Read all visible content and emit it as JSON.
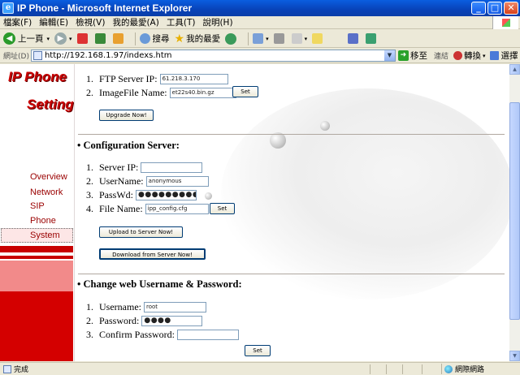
{
  "window": {
    "title": "IP Phone - Microsoft Internet Explorer",
    "minimize": "_",
    "maximize": "□",
    "close": "✕"
  },
  "menu": [
    "檔案(F)",
    "編輯(E)",
    "檢視(V)",
    "我的最愛(A)",
    "工具(T)",
    "說明(H)"
  ],
  "toolbar": {
    "back_label": "上一頁",
    "search_label": "搜尋",
    "favorites_label": "我的最愛"
  },
  "address": {
    "label": "網址(D)",
    "url": "http://192.168.1.97/indexs.htm",
    "go_label": "移至",
    "links_label": "連結",
    "convert_label": "轉換",
    "select_label": "選擇"
  },
  "sidebar": {
    "logo_line1": "IP Phone",
    "logo_line2": "Setting",
    "items": [
      {
        "label": "Overview"
      },
      {
        "label": "Network"
      },
      {
        "label": "SIP"
      },
      {
        "label": "Phone"
      },
      {
        "label": "System"
      }
    ],
    "selected": "System"
  },
  "upgrade": {
    "ftp_label": "FTP Server IP:",
    "ftp_value": "61.218.3.170",
    "image_label": "ImageFile Name:",
    "image_value": "et22s40.bin.gz",
    "set_label": "Set",
    "upgrade_button": "Upgrade Now!"
  },
  "config_server": {
    "title": "Configuration Server:",
    "server_ip_label": "Server IP:",
    "server_ip_value": "",
    "username_label": "UserName:",
    "username_value": "anonymous",
    "passwd_label": "PassWd:",
    "passwd_value": "●●●●●●●●●●",
    "filename_label": "File Name:",
    "filename_value": "ipp_config.cfg",
    "set_label": "Set",
    "upload_button": "Upload to Server Now!",
    "download_button": "Download from Server Now!"
  },
  "web_credentials": {
    "title": "Change web Username & Password:",
    "username_label": "Username:",
    "username_value": "root",
    "password_label": "Password:",
    "password_value": "●●●●",
    "confirm_label": "Confirm Password:",
    "confirm_value": "",
    "set_label": "Set"
  },
  "numbers": [
    "1.",
    "2.",
    "3.",
    "4."
  ],
  "bullet": "•",
  "status": {
    "text": "完成",
    "zone": "網際網路"
  }
}
